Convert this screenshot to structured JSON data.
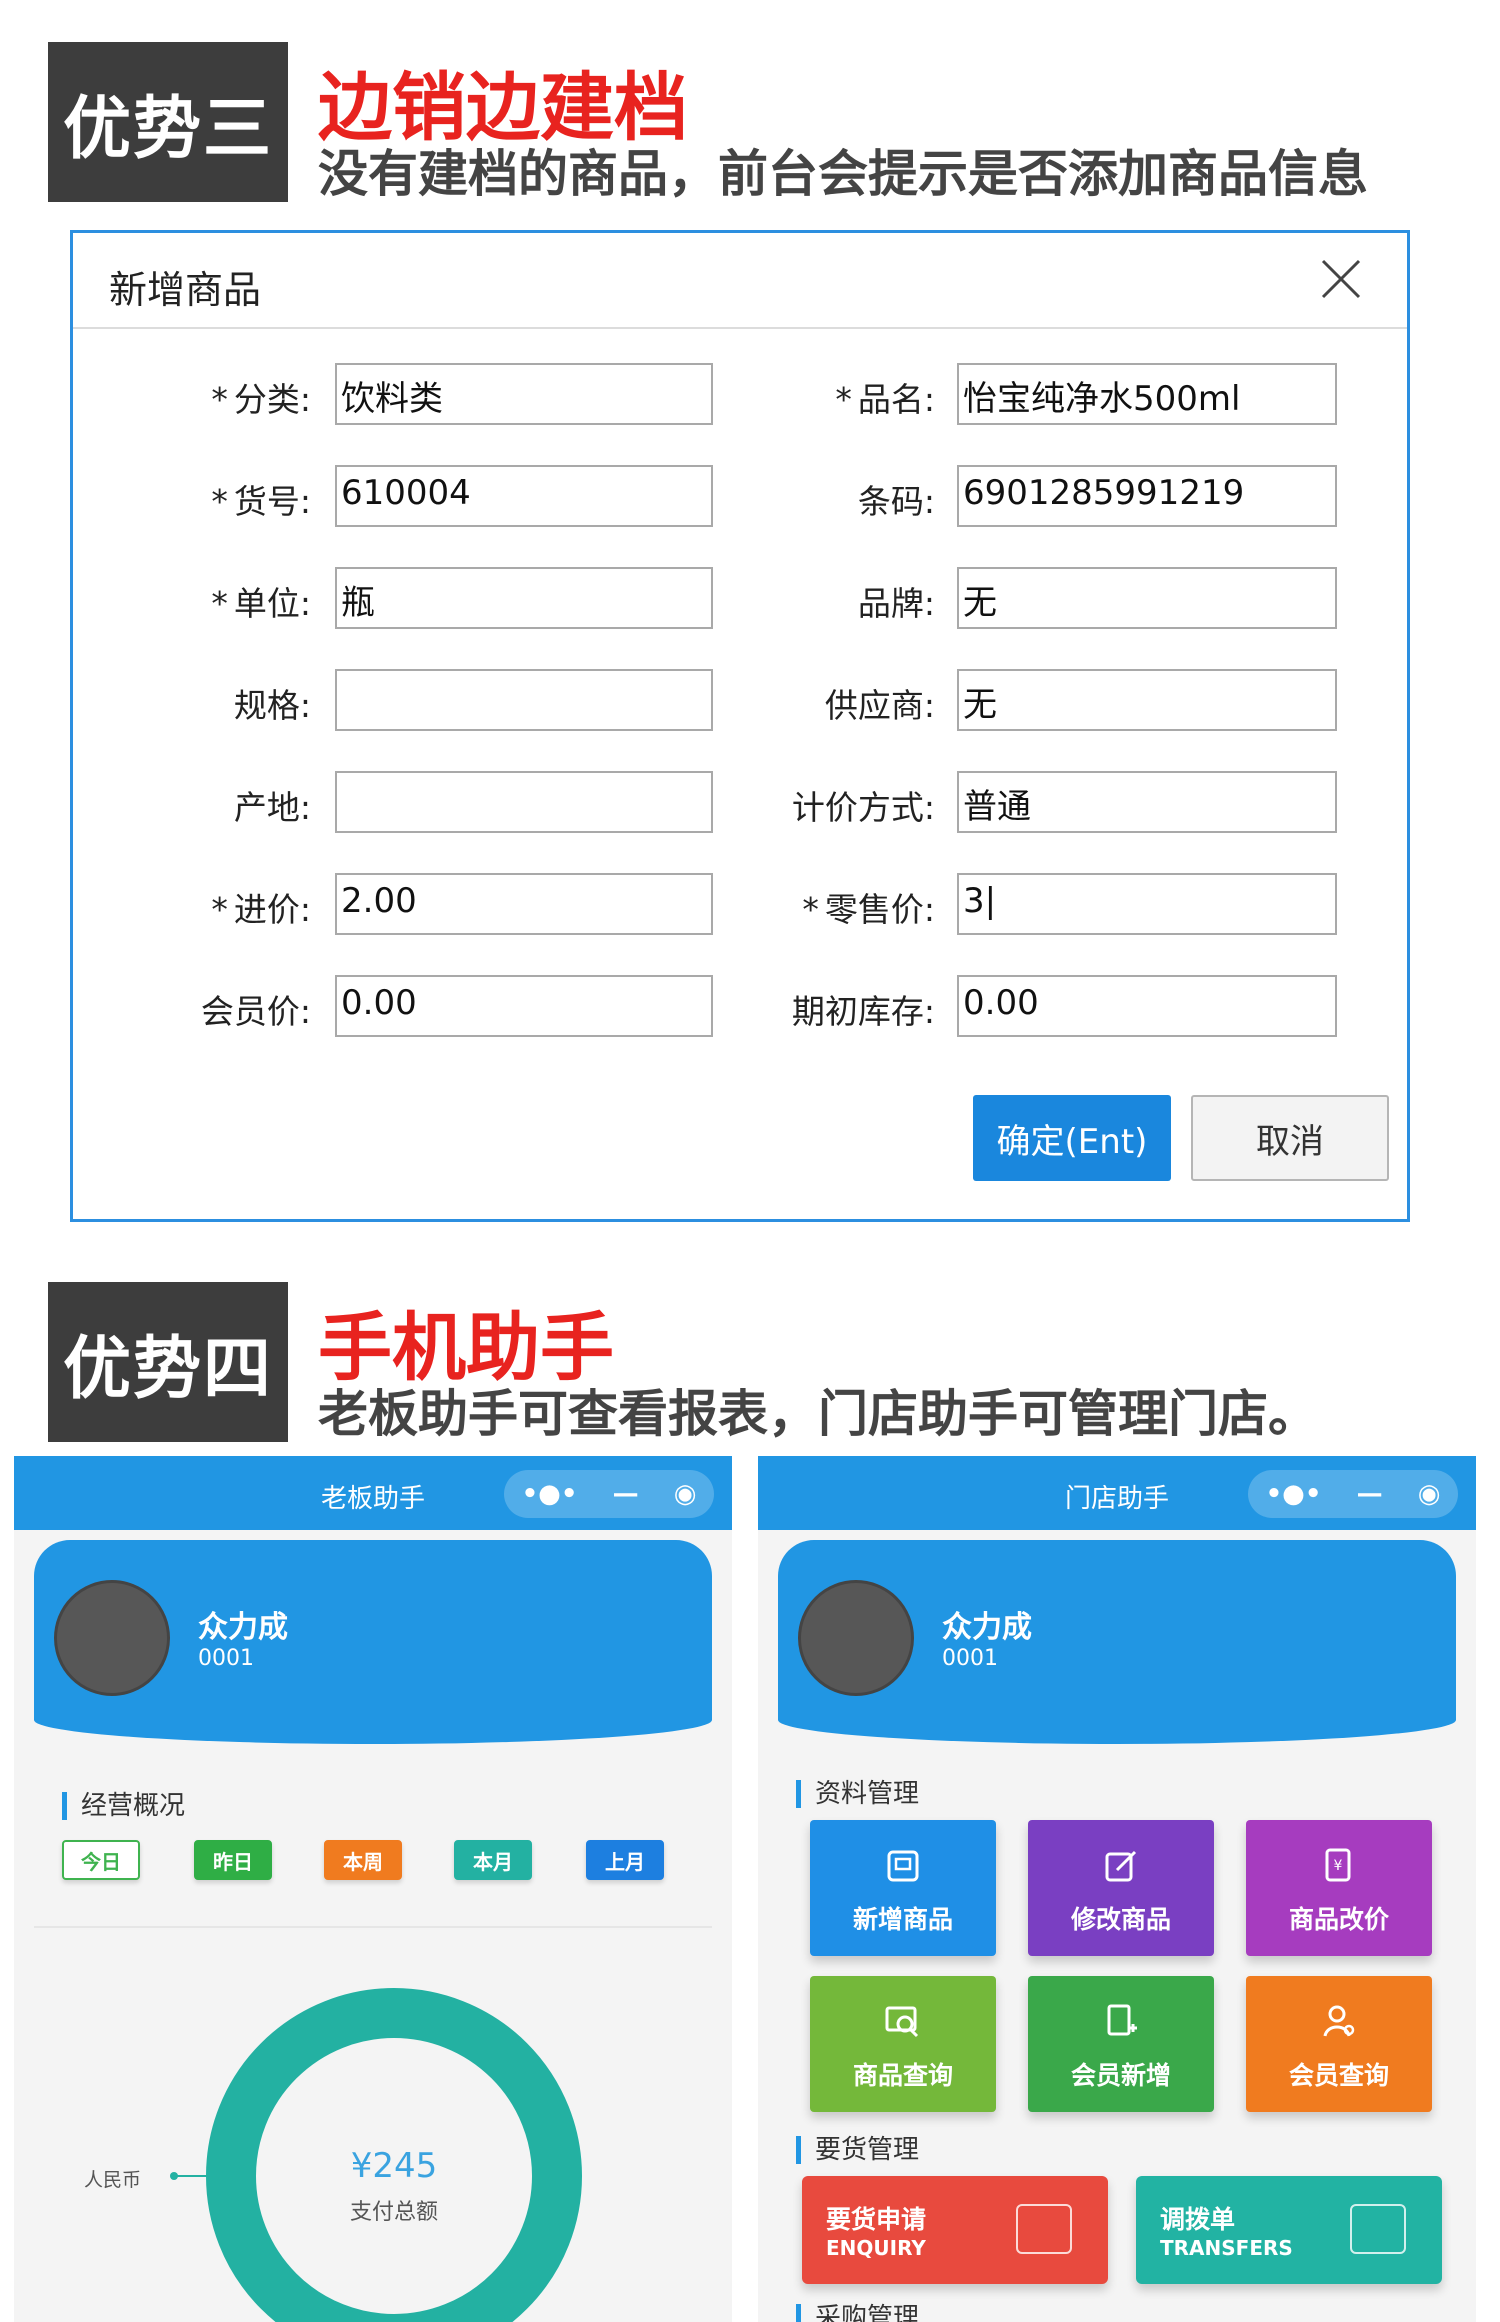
{
  "section3": {
    "badge": "优势三",
    "title": "边销边建档",
    "subtitle": "没有建档的商品，前台会提示是否添加商品信息"
  },
  "dialog": {
    "title": "新增商品",
    "close_icon": "close-icon",
    "left_fields": [
      {
        "label": "分类:",
        "required": "*",
        "value": "饮料类"
      },
      {
        "label": "货号:",
        "required": "*",
        "value": "610004"
      },
      {
        "label": "单位:",
        "required": "*",
        "value": "瓶"
      },
      {
        "label": "规格:",
        "required": "",
        "value": ""
      },
      {
        "label": "产地:",
        "required": "",
        "value": ""
      },
      {
        "label": "进价:",
        "required": "*",
        "value": "2.00"
      },
      {
        "label": "会员价:",
        "required": "",
        "value": "0.00"
      }
    ],
    "right_fields": [
      {
        "label": "品名:",
        "required": "*",
        "value": "怡宝纯净水500ml"
      },
      {
        "label": "条码:",
        "required": "",
        "value": "6901285991219"
      },
      {
        "label": "品牌:",
        "required": "",
        "value": "无"
      },
      {
        "label": "供应商:",
        "required": "",
        "value": "无"
      },
      {
        "label": "计价方式:",
        "required": "",
        "value": "普通"
      },
      {
        "label": "零售价:",
        "required": "*",
        "value": "3|"
      },
      {
        "label": "期初库存:",
        "required": "",
        "value": "0.00"
      }
    ],
    "ok_label": "确定(Ent)",
    "cancel_label": "取消"
  },
  "section4": {
    "badge": "优势四",
    "title": "手机助手",
    "subtitle": "老板助手可查看报表，门店助手可管理门店。"
  },
  "boss": {
    "bar_title": "老板助手",
    "capsule": {
      "more": "•●•",
      "minus": "—",
      "target": "◉"
    },
    "name": "众力成",
    "code": "0001",
    "section_label": "经营概况",
    "periods": [
      {
        "label": "今日",
        "color": "#ffffff",
        "text": "#3fb34f",
        "border": "#3fb34f"
      },
      {
        "label": "昨日",
        "color": "#2fae45",
        "text": "#ffffff",
        "border": "#2fae45"
      },
      {
        "label": "本周",
        "color": "#f07b1f",
        "text": "#ffffff",
        "border": "#f07b1f"
      },
      {
        "label": "本月",
        "color": "#23b1a2",
        "text": "#ffffff",
        "border": "#23b1a2"
      },
      {
        "label": "上月",
        "color": "#1d7fe0",
        "text": "#ffffff",
        "border": "#1d7fe0"
      }
    ],
    "donut_label": "人民币",
    "amount": "¥245",
    "amount_label": "支付总额",
    "donut_color": "#23b1a2"
  },
  "store": {
    "bar_title": "门店助手",
    "capsule": {
      "more": "•●•",
      "minus": "—",
      "target": "◉"
    },
    "name": "众力成",
    "code": "0001",
    "section_data": "资料管理",
    "tiles": [
      {
        "label": "新增商品",
        "color": "#1f8fe6",
        "icon": "box-icon"
      },
      {
        "label": "修改商品",
        "color": "#7a3fc2",
        "icon": "edit-icon"
      },
      {
        "label": "商品改价",
        "color": "#a63cbf",
        "icon": "price-tag-icon"
      },
      {
        "label": "商品查询",
        "color": "#74b83a",
        "icon": "search-product-icon"
      },
      {
        "label": "会员新增",
        "color": "#3aa84a",
        "icon": "add-member-icon"
      },
      {
        "label": "会员查询",
        "color": "#f07b1f",
        "icon": "member-search-icon"
      }
    ],
    "section_order": "要货管理",
    "wide": [
      {
        "cn": "要货申请",
        "en": "ENQUIRY",
        "color": "#e84a3e",
        "icon": "calendar-icon"
      },
      {
        "cn": "调拨单",
        "en": "TRANSFERS",
        "color": "#22b3a3",
        "icon": "clipboard-icon"
      }
    ],
    "section_purchase": "采购管理"
  }
}
